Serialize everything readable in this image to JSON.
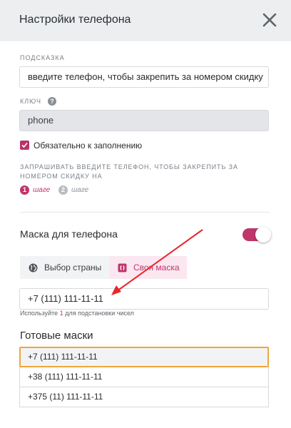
{
  "header": {
    "title": "Настройки телефона"
  },
  "hint_section": {
    "label": "Подсказка",
    "value": "введите телефон, чтобы закрепить за номером скидку"
  },
  "key_section": {
    "label": "Ключ",
    "help_glyph": "?",
    "value": "phone"
  },
  "required": {
    "label": "Обязательно к заполнению",
    "checked": true
  },
  "ask": {
    "text": "Запрашивать введите телефон, чтобы закрепить за номером скидку на",
    "steps": [
      {
        "num": "1",
        "label": "шаге",
        "active": true
      },
      {
        "num": "2",
        "label": "шаге",
        "active": false
      }
    ]
  },
  "mask": {
    "title": "Маска для телефона",
    "enabled": true,
    "tabs": [
      {
        "label": "Выбор страны",
        "icon": "globe-icon",
        "active": false
      },
      {
        "label": "Своя маска",
        "icon": "brackets-icon",
        "active": true
      }
    ],
    "value": "+7 (111) 111-11-11",
    "hint_prefix": "Используйте ",
    "hint_num": "1",
    "hint_suffix": " для подстановки чисел"
  },
  "ready": {
    "title": "Готовые маски",
    "items": [
      "+7 (111) 111-11-11",
      "+38 (111) 111-11-11",
      "+375 (11) 111-11-11"
    ],
    "selected_index": 0
  },
  "colors": {
    "accent": "#c0356c",
    "selected_border": "#f0a63a",
    "arrow": "#e8262a"
  }
}
